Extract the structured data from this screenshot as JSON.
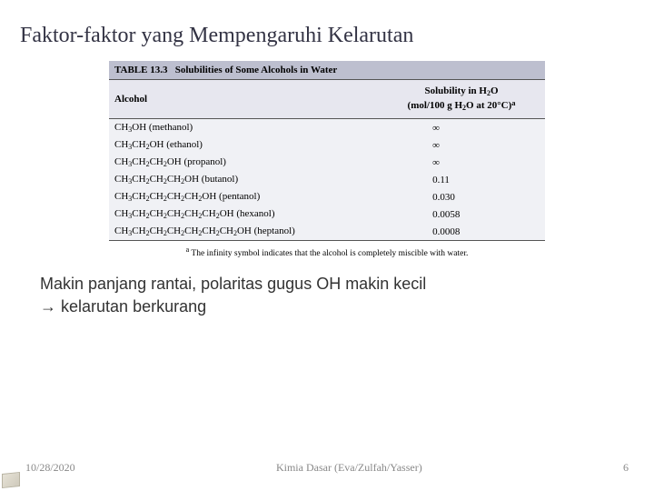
{
  "title": "Faktor-faktor yang Mempengaruhi Kelarutan",
  "table": {
    "caption_label": "TABLE 13.3",
    "caption_text": "Solubilities of Some Alcohols in Water",
    "headers": [
      "Alcohol"
    ],
    "header2_line1": "Solubility in",
    "rows": [
      {
        "name": "methanol",
        "value": "∞"
      },
      {
        "name": "ethanol",
        "value": "∞"
      },
      {
        "name": "propanol",
        "value": "∞"
      },
      {
        "name": "butanol",
        "value": "0.11"
      },
      {
        "name": "pentanol",
        "value": "0.030"
      },
      {
        "name": "hexanol",
        "value": "0.0058"
      },
      {
        "name": "heptanol",
        "value": "0.0008"
      }
    ],
    "footnote": "The infinity symbol indicates that the alcohol is completely miscible with water."
  },
  "conclusion": {
    "line1": "Makin panjang rantai, polaritas gugus OH makin kecil",
    "arrow": "→",
    "line2": "kelarutan berkurang"
  },
  "footer": {
    "date": "10/28/2020",
    "center": "Kimia Dasar (Eva/Zulfah/Yasser)",
    "page": "6"
  }
}
